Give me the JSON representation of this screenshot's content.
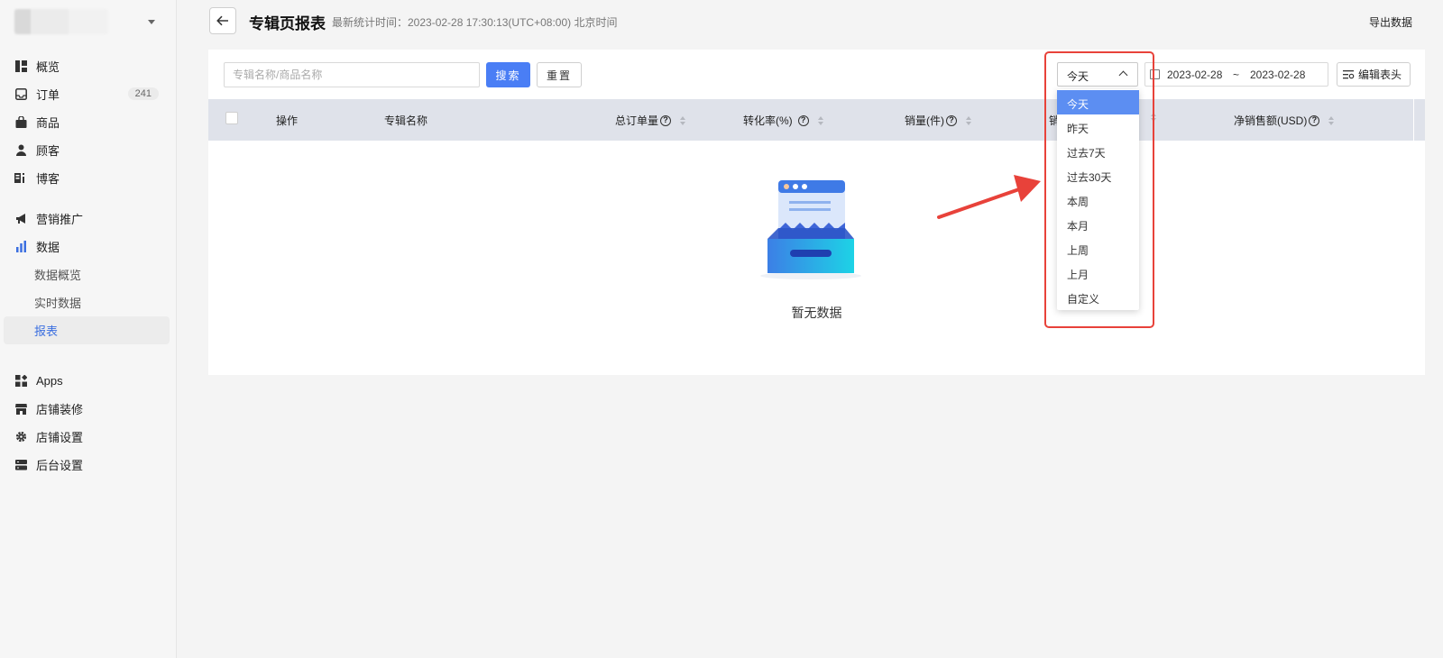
{
  "sidebar": {
    "items": [
      {
        "label": "概览",
        "icon": "dashboard-icon"
      },
      {
        "label": "订单",
        "icon": "inbox-icon",
        "badge": "241"
      },
      {
        "label": "商品",
        "icon": "bag-icon"
      },
      {
        "label": "顾客",
        "icon": "user-icon"
      },
      {
        "label": "博客",
        "icon": "blog-icon"
      },
      {
        "label": "营销推广",
        "icon": "megaphone-icon"
      },
      {
        "label": "数据",
        "icon": "bar-chart-icon"
      },
      {
        "label": "数据概览"
      },
      {
        "label": "实时数据"
      },
      {
        "label": "报表"
      },
      {
        "label": "Apps",
        "icon": "apps-icon"
      },
      {
        "label": "店铺装修",
        "icon": "store-icon"
      },
      {
        "label": "店铺设置",
        "icon": "gear-icon"
      },
      {
        "label": "后台设置",
        "icon": "server-icon"
      }
    ]
  },
  "header": {
    "title": "专辑页报表",
    "stat_time": "最新统计时间：2023-02-28 17:30:13(UTC+08:00) 北京时间",
    "export": "导出数据"
  },
  "toolbar": {
    "search_placeholder": "专辑名称/商品名称",
    "search_btn": "搜索",
    "reset_btn": "重置",
    "range_value": "今天",
    "date_start": "2023-02-28",
    "date_sep": "~",
    "date_end": "2023-02-28",
    "columns_btn": "编辑表头"
  },
  "table": {
    "columns": [
      "操作",
      "专辑名称",
      "总订单量",
      "转化率(%)",
      "销量(件)",
      "销",
      "净销售额(USD)"
    ],
    "empty_text": "暂无数据"
  },
  "dropdown": {
    "options": [
      "今天",
      "昨天",
      "过去7天",
      "过去30天",
      "本周",
      "本月",
      "上周",
      "上月",
      "自定义"
    ],
    "selected": "今天"
  },
  "colors": {
    "accent": "#4a7ef5",
    "selected_option": "#5c8ef2",
    "annotation": "#e8423a",
    "table_header": "#dfe2ea"
  }
}
